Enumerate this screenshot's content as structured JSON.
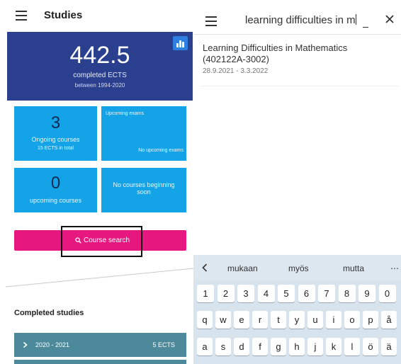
{
  "left": {
    "header": {
      "title": "Studies"
    },
    "ects": {
      "value": "442.5",
      "label": "completed ECTS",
      "range": "between 1994-2020"
    },
    "ongoing": {
      "count": "3",
      "label": "Ongoing courses",
      "sub": "15 ECTS in total"
    },
    "exams": {
      "title": "Upcoming exams",
      "status": "No upcoming exams"
    },
    "upcoming": {
      "count": "0",
      "label": "upcoming courses"
    },
    "beginning": {
      "text": "No courses beginning soon"
    },
    "search_button": {
      "label": "Course search"
    },
    "completed": {
      "title": "Completed studies"
    },
    "year_rows": [
      {
        "years": "2020 - 2021",
        "ects": "5 ECTS"
      }
    ]
  },
  "right": {
    "search": {
      "query": "learning difficulties in m"
    },
    "result": {
      "title": "Learning Difficulties in Mathematics (402122A-3002)",
      "dates": "28.9.2021 - 3.3.2022"
    },
    "keyboard": {
      "suggestions": [
        "mukaan",
        "myös",
        "mutta"
      ],
      "row_numbers": [
        "1",
        "2",
        "3",
        "4",
        "5",
        "6",
        "7",
        "8",
        "9",
        "0"
      ],
      "row_top": [
        "q",
        "w",
        "e",
        "r",
        "t",
        "y",
        "u",
        "i",
        "o",
        "p",
        "å"
      ],
      "row_middle": [
        "a",
        "s",
        "d",
        "f",
        "g",
        "h",
        "j",
        "k",
        "l",
        "ö",
        "ä"
      ]
    }
  },
  "icons": {
    "menu": "hamburger-menu-icon",
    "chart": "bar-chart-icon",
    "search": "magnifier-icon",
    "chevron": "chevron-right-icon",
    "close": "close-icon",
    "back": "chevron-left-icon",
    "more": "more-dots-icon"
  },
  "colors": {
    "ects_card": "#2a3f8d",
    "tile": "#13a3e6",
    "search_button": "#e6187f",
    "year_row": "#4c8a9b",
    "keyboard": "#d7e3ed"
  }
}
